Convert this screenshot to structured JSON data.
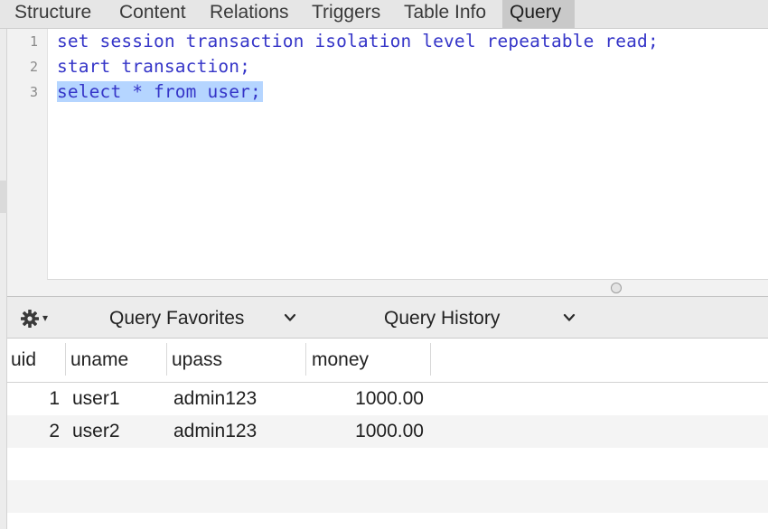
{
  "tabs": [
    {
      "label": "Structure"
    },
    {
      "label": "Content"
    },
    {
      "label": "Relations"
    },
    {
      "label": "Triggers"
    },
    {
      "label": "Table Info"
    },
    {
      "label": "Query",
      "active": true
    }
  ],
  "editor": {
    "lines": [
      {
        "number": "1",
        "text": "set session transaction isolation level repeatable read;"
      },
      {
        "number": "2",
        "text": "start transaction;"
      },
      {
        "number": "3",
        "text": "select * from user;",
        "selected": true
      }
    ],
    "keyword_color": "#3535c8",
    "selection_color": "#b5d5ff"
  },
  "toolbar": {
    "gear_icon": "gear-icon",
    "favorites_label": "Query Favorites",
    "history_label": "Query History"
  },
  "results": {
    "columns": [
      "uid",
      "uname",
      "upass",
      "money"
    ],
    "rows": [
      {
        "uid": "1",
        "uname": "user1",
        "upass": "admin123",
        "money": "1000.00"
      },
      {
        "uid": "2",
        "uname": "user2",
        "upass": "admin123",
        "money": "1000.00"
      }
    ]
  }
}
